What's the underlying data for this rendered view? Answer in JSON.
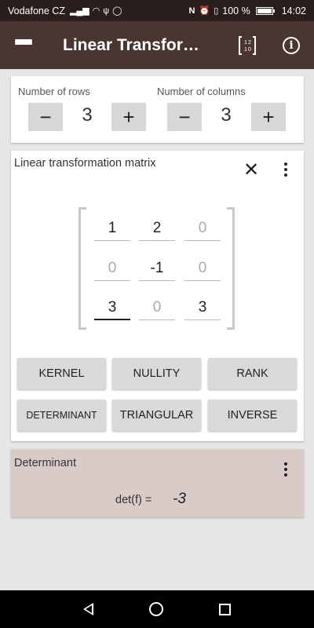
{
  "status_bar": {
    "carrier": "Vodafone CZ",
    "battery_text": "100 %",
    "battery_level": 1.0,
    "time": "14:02",
    "icons": [
      "signal-icon",
      "wifi-icon",
      "usb-icon",
      "whatsapp-icon",
      "nfc-icon",
      "alarm-icon",
      "vibrate-icon",
      "battery-icon"
    ]
  },
  "app_bar": {
    "menu_icon": "hamburger-menu-icon",
    "title": "Linear Transformation",
    "matrix_icon": "matrix-icon",
    "matrix_icon_digits": [
      "1",
      "2",
      "1",
      "0"
    ],
    "info_icon": "info-icon",
    "info_glyph": "i"
  },
  "dimensions": {
    "rows_label": "Number of rows",
    "rows_value": "3",
    "columns_label": "Number of columns",
    "columns_value": "3",
    "minus_glyph": "−",
    "plus_glyph": "+"
  },
  "matrix_card": {
    "title": "Linear transformation matrix",
    "close_glyph": "✕",
    "cells": [
      [
        {
          "value": "1",
          "hint": false
        },
        {
          "value": "2",
          "hint": false
        },
        {
          "value": "0",
          "hint": true
        }
      ],
      [
        {
          "value": "0",
          "hint": true
        },
        {
          "value": "-1",
          "hint": false
        },
        {
          "value": "0",
          "hint": true
        }
      ],
      [
        {
          "value": "3",
          "hint": false
        },
        {
          "value": "0",
          "hint": true
        },
        {
          "value": "3",
          "hint": false
        }
      ]
    ],
    "buttons": {
      "kernel": "KERNEL",
      "nullity": "NULLITY",
      "rank": "RANK",
      "determinant": "DETERMINANT",
      "triangular": "TRIANGULAR",
      "inverse": "INVERSE"
    }
  },
  "result_card": {
    "title": "Determinant",
    "expression": "det(f) =",
    "value": "-3"
  },
  "nav_bar": {
    "back_icon": "back-icon",
    "home_icon": "home-icon",
    "recents_icon": "recents-icon"
  },
  "colors": {
    "status_bar": "#2a1e1c",
    "app_bar": "#4a3530",
    "result_card": "#d9ccc8",
    "background": "#e6e6e6"
  }
}
